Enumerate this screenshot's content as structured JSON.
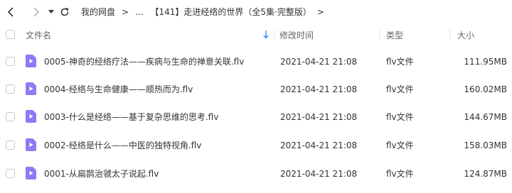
{
  "breadcrumb": {
    "root": "我的网盘",
    "sep": ">",
    "ellipsis": "...",
    "current": "【141】走进经络的世界（全5集·完整版）",
    "end_sep": ">"
  },
  "columns": {
    "name": "文件名",
    "modified": "修改时间",
    "type": "类型",
    "size": "大小"
  },
  "files": [
    {
      "name": "0005-神奇的经络疗法——疾病与生命的禅意关联.flv",
      "modified": "2021-04-21 21:08",
      "type": "flv文件",
      "size": "111.95MB"
    },
    {
      "name": "0004-经络与生命健康——顺热而为.flv",
      "modified": "2021-04-21 21:08",
      "type": "flv文件",
      "size": "160.02MB"
    },
    {
      "name": "0003-什么是经络——基于复杂思维的思考.flv",
      "modified": "2021-04-21 21:08",
      "type": "flv文件",
      "size": "144.67MB"
    },
    {
      "name": "0002-经络是什么——中医的独特视角.flv",
      "modified": "2021-04-21 21:08",
      "type": "flv文件",
      "size": "158.03MB"
    },
    {
      "name": "0001-从扁鹊治虢太子说起.flv",
      "modified": "2021-04-21 21:08",
      "type": "flv文件",
      "size": "124.87MB"
    }
  ],
  "colors": {
    "file_icon": "#8b7cf6",
    "sort_arrow": "#3a8ef6"
  }
}
